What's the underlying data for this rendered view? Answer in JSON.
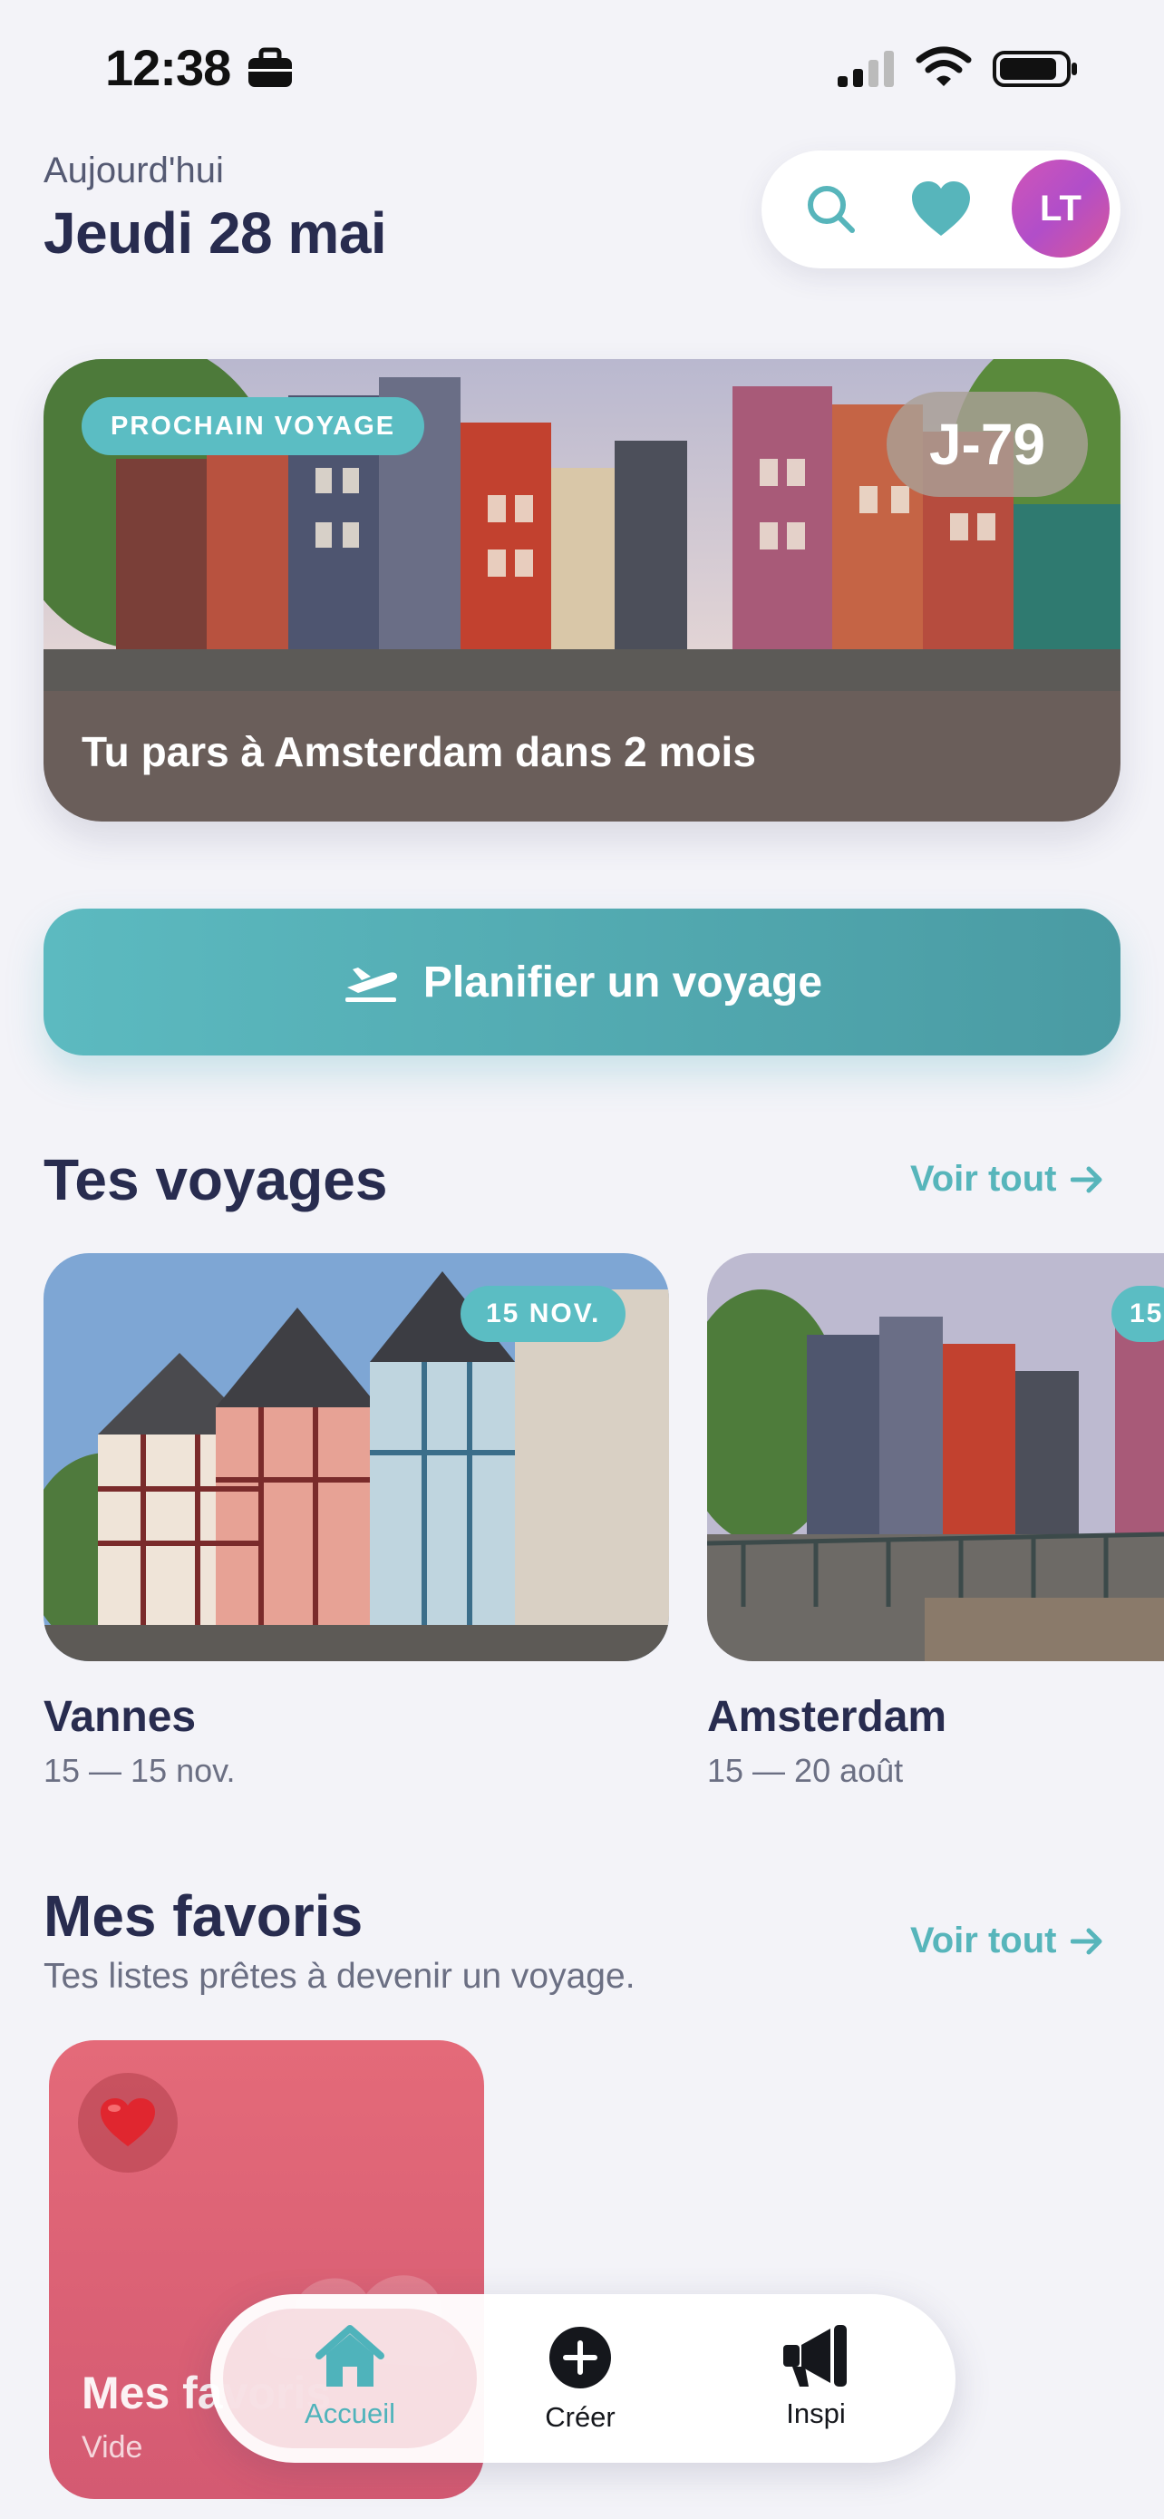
{
  "status_bar": {
    "time": "12:38"
  },
  "header": {
    "today_label": "Aujourd'hui",
    "date": "Jeudi 28 mai",
    "avatar_initials": "LT"
  },
  "next_trip": {
    "badge": "PROCHAIN VOYAGE",
    "countdown": "J-79",
    "title": "Tu pars à Amsterdam dans 2 mois"
  },
  "plan_button": {
    "label": "Planifier un voyage"
  },
  "trips_section": {
    "title": "Tes voyages",
    "see_all": "Voir tout",
    "trips": [
      {
        "badge": "15 NOV.",
        "name": "Vannes",
        "dates": "15 — 15 nov."
      },
      {
        "badge": "15",
        "name": "Amsterdam",
        "dates": "15 — 20 août"
      }
    ]
  },
  "favorites_section": {
    "title": "Mes favoris",
    "subtitle": "Tes listes prêtes à devenir un voyage.",
    "see_all": "Voir tout",
    "lists": [
      {
        "name": "Mes favoris",
        "sub": "Vide"
      }
    ]
  },
  "bottom_nav": {
    "items": [
      {
        "label": "Accueil",
        "icon": "home-icon",
        "active": true
      },
      {
        "label": "Créer",
        "icon": "plus-circle-icon",
        "active": false
      },
      {
        "label": "Inspi",
        "icon": "megaphone-icon",
        "active": false
      }
    ]
  },
  "colors": {
    "background": "#f3f3f8",
    "accent_teal": "#5bbdc3",
    "title_navy": "#282c4f",
    "favorites_pink": "#e46a79",
    "avatar_purple": "#b14ec9"
  }
}
